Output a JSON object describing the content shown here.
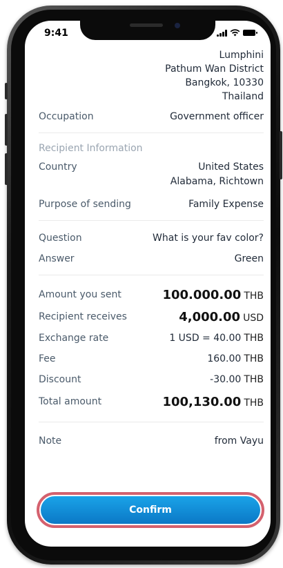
{
  "status": {
    "time": "9:41"
  },
  "address": {
    "line1": "Lumphini",
    "line2": "Pathum Wan District",
    "line3": "Bangkok, 10330",
    "line4": "Thailand"
  },
  "occupation": {
    "label": "Occupation",
    "value": "Government officer"
  },
  "recipient": {
    "title": "Recipient Information",
    "country_label": "Country",
    "country_value": "United States",
    "country_value_line2": "Alabama, Richtown",
    "purpose_label": "Purpose of sending",
    "purpose_value": "Family Expense"
  },
  "security": {
    "question_label": "Question",
    "question_value": "What is your fav color?",
    "answer_label": "Answer",
    "answer_value": "Green"
  },
  "amounts": {
    "sent_label": "Amount you sent",
    "sent_value": "100.000.00",
    "sent_currency": "THB",
    "receives_label": "Recipient receives",
    "receives_value": "4,000.00",
    "receives_currency": "USD",
    "rate_label": "Exchange rate",
    "rate_value": "1 USD = 40.00",
    "rate_currency": "THB",
    "fee_label": "Fee",
    "fee_value": "160.00",
    "fee_currency": "THB",
    "discount_label": "Discount",
    "discount_value": "-30.00",
    "discount_currency": "THB",
    "total_label": "Total amount",
    "total_value": "100,130.00",
    "total_currency": "THB"
  },
  "note": {
    "label": "Note",
    "value": "from Vayu"
  },
  "confirm": {
    "label": "Confirm"
  }
}
